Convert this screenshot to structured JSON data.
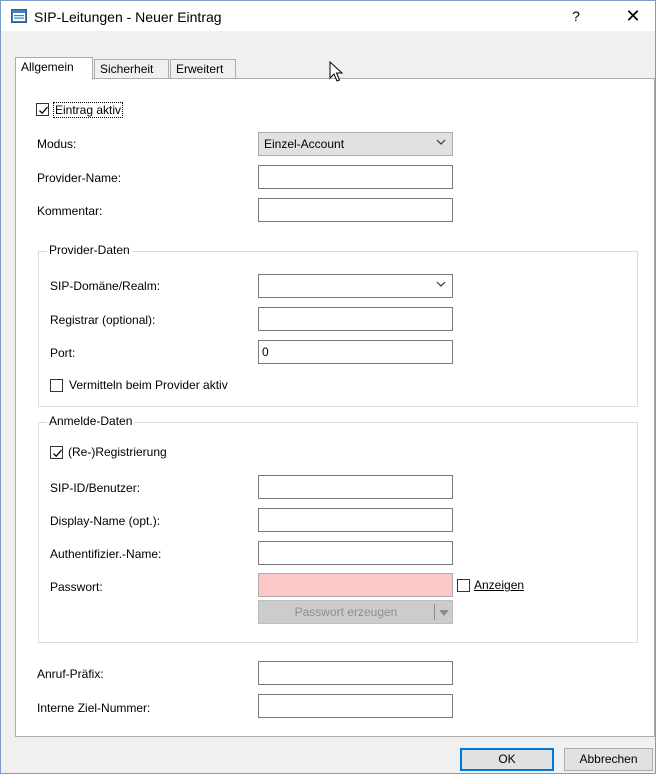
{
  "window": {
    "title": "SIP-Leitungen - Neuer Eintrag",
    "help_label": "?",
    "close_label": "✕"
  },
  "tabs": [
    {
      "label": "Allgemein",
      "active": true
    },
    {
      "label": "Sicherheit",
      "active": false
    },
    {
      "label": "Erweitert",
      "active": false
    }
  ],
  "general": {
    "entry_active": {
      "label": "Eintrag aktiv",
      "checked": true
    },
    "mode": {
      "label": "Modus:",
      "value": "Einzel-Account"
    },
    "provider_name": {
      "label": "Provider-Name:",
      "value": ""
    },
    "comment": {
      "label": "Kommentar:",
      "value": ""
    }
  },
  "provider_data": {
    "title": "Provider-Daten",
    "sip_domain": {
      "label": "SIP-Domäne/Realm:",
      "value": ""
    },
    "registrar": {
      "label": "Registrar (optional):",
      "value": ""
    },
    "port": {
      "label": "Port:",
      "value": "0"
    },
    "switch_at_provider": {
      "label": "Vermitteln beim Provider aktiv",
      "checked": false
    }
  },
  "login_data": {
    "title": "Anmelde-Daten",
    "reregistration": {
      "label": "(Re-)Registrierung",
      "checked": true
    },
    "sip_id": {
      "label": "SIP-ID/Benutzer:",
      "value": ""
    },
    "display_name": {
      "label": "Display-Name (opt.):",
      "value": ""
    },
    "auth_name": {
      "label": "Authentifizier.-Name:",
      "value": ""
    },
    "password": {
      "label": "Passwort:",
      "value": ""
    },
    "show_password": {
      "label": "Anzeigen",
      "checked": false
    },
    "generate_password": {
      "label": "Passwort erzeugen"
    }
  },
  "call": {
    "prefix": {
      "label": "Anruf-Präfix:",
      "value": ""
    },
    "internal_target": {
      "label": "Interne Ziel-Nummer:",
      "value": ""
    }
  },
  "footer": {
    "ok_label": "OK",
    "cancel_label": "Abbrechen"
  },
  "colors": {
    "password_invalid_bg": "#ffc8c8",
    "default_button_border": "#0078d7"
  },
  "icons": {
    "app": "window-icon",
    "cursor": "mouse-pointer-icon"
  }
}
